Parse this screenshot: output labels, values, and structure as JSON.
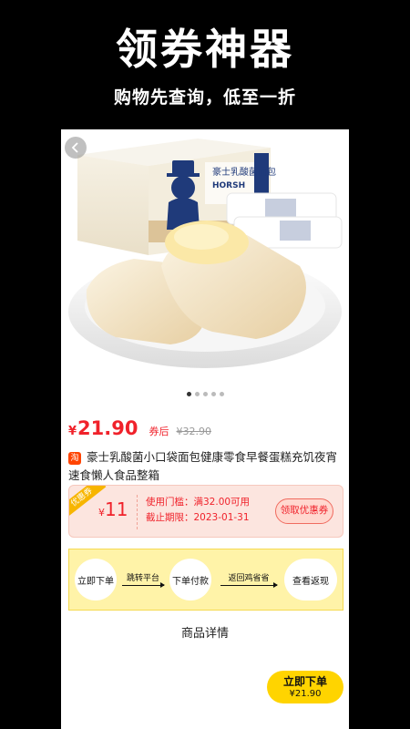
{
  "banner": {
    "headline": "领券神器",
    "subhead": "购物先查询，低至一折"
  },
  "product": {
    "currency": "¥",
    "price": "21.90",
    "price_tag": "券后",
    "original_price": "¥32.90",
    "platform_badge": "淘",
    "title": "豪士乳酸菌小口袋面包健康零食早餐蛋糕充饥夜宵速食懒人食品整箱",
    "image_brand_text": "豪士乳酸菌面包",
    "image_brand_en": "HORSH",
    "carousel_count": 5,
    "carousel_active": 0
  },
  "coupon": {
    "ribbon": "优惠券",
    "currency": "¥",
    "amount": "11",
    "threshold": "使用门槛：满32.00可用",
    "deadline": "截止期限：2023-01-31",
    "claim_label": "领取优惠券"
  },
  "flow": {
    "steps": [
      "立即下单",
      "下单付款",
      "查看返现"
    ],
    "arrows": [
      "跳转平台",
      "返回鸡省省"
    ]
  },
  "details": {
    "title": "商品详情"
  },
  "order_button": {
    "label": "立即下单",
    "price": "¥21.90"
  },
  "colors": {
    "accent_red": "#f0222b",
    "yellow": "#ffd400",
    "flow_bg": "#fff3a8",
    "coupon_bg": "#fce5df"
  }
}
